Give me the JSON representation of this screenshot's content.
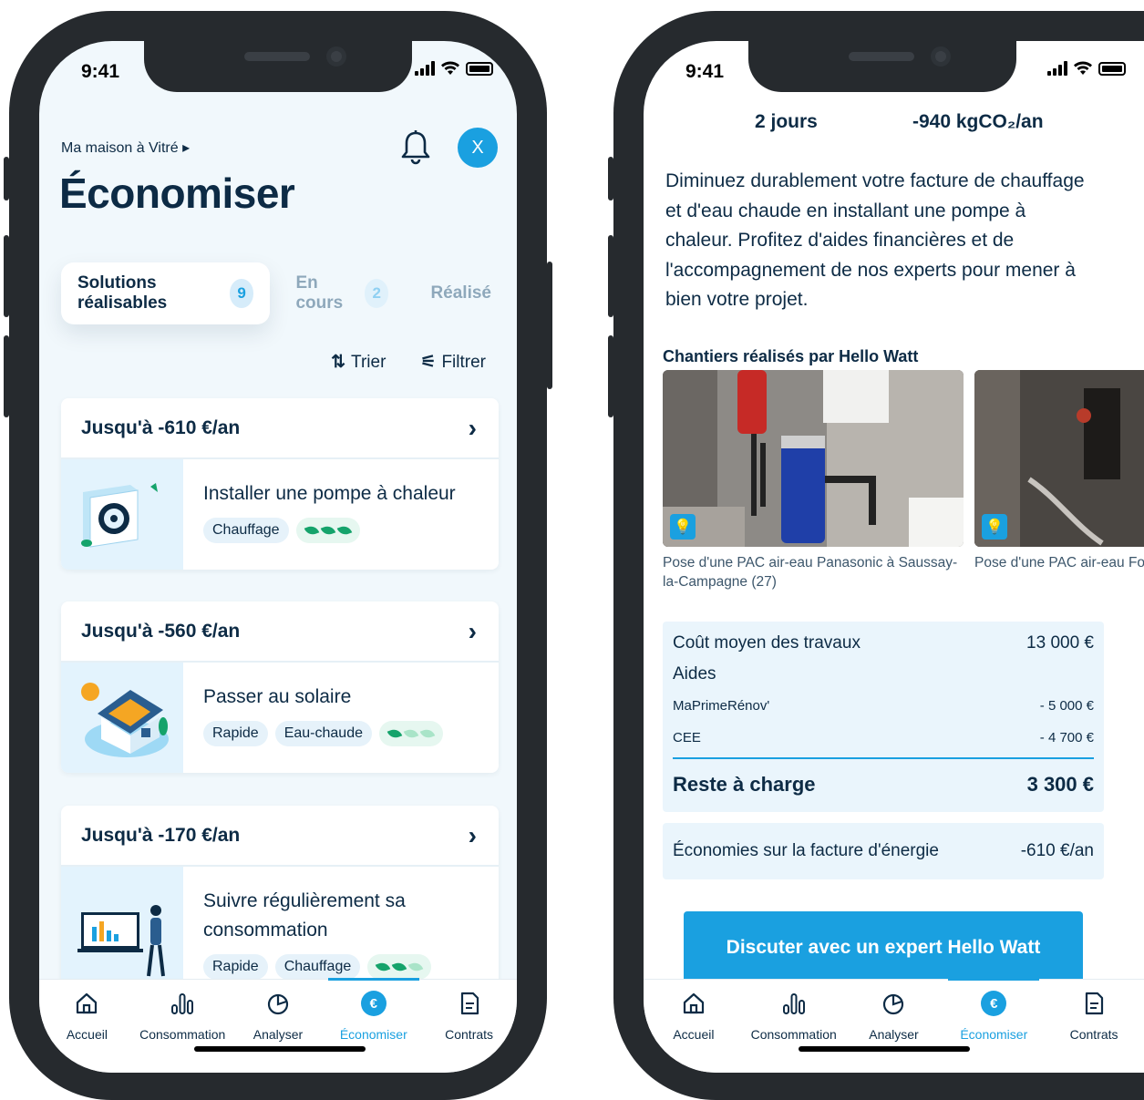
{
  "status": {
    "time": "9:41"
  },
  "left": {
    "breadcrumb": "Ma maison à Vitré ▸",
    "avatar_initial": "X",
    "title": "Économiser",
    "tabs": [
      {
        "label": "Solutions réalisables",
        "count": "9"
      },
      {
        "label": "En cours",
        "count": "2"
      },
      {
        "label": "Réalisé"
      }
    ],
    "sort_label": "Trier",
    "filter_label": "Filtrer",
    "cards": [
      {
        "saving": "Jusqu'à -610 €/an",
        "title": "Installer une pompe à chaleur",
        "tags": [
          "Chauffage"
        ],
        "impact_leaves": 3
      },
      {
        "saving": "Jusqu'à -560 €/an",
        "title": "Passer au solaire",
        "tags": [
          "Rapide",
          "Eau-chaude"
        ],
        "impact_leaves": 1
      },
      {
        "saving": "Jusqu'à -170 €/an",
        "title": "Suivre régulièrement sa consommation",
        "tags": [
          "Rapide",
          "Chauffage"
        ],
        "impact_leaves": 2
      }
    ]
  },
  "nav": {
    "items": [
      "Accueil",
      "Consommation",
      "Analyser",
      "Économiser",
      "Contrats"
    ],
    "active": "Économiser",
    "accent": "#1aa0e0"
  },
  "right": {
    "duration": "2 jours",
    "co2": "-940 kgCO₂/an",
    "description": "Diminuez durablement votre facture de chauffage et d'eau chaude en installant une pompe à chaleur. Profitez d'aides financières et de l'accompagnement de nos experts pour mener à bien votre projet.",
    "section_title": "Chantiers réalisés par Hello Watt",
    "projects": [
      {
        "caption": "Pose d'une PAC air-eau Panasonic à Saussay-la-Campagne (27)"
      },
      {
        "caption": "Pose d'une PAC air-eau Fontaines-Saint-Marti"
      }
    ],
    "costs": {
      "average_label": "Coût moyen des travaux",
      "average_value": "13 000 €",
      "aids_label": "Aides",
      "aids": [
        {
          "label": "MaPrimeRénov'",
          "value": "- 5 000 €"
        },
        {
          "label": "CEE",
          "value": "- 4 700 €"
        }
      ],
      "remaining_label": "Reste à charge",
      "remaining_value": "3 300 €"
    },
    "savings_label": "Économies sur la facture d'énergie",
    "savings_value": "-610 €/an",
    "cta_label": "Discuter avec un expert Hello Watt"
  }
}
